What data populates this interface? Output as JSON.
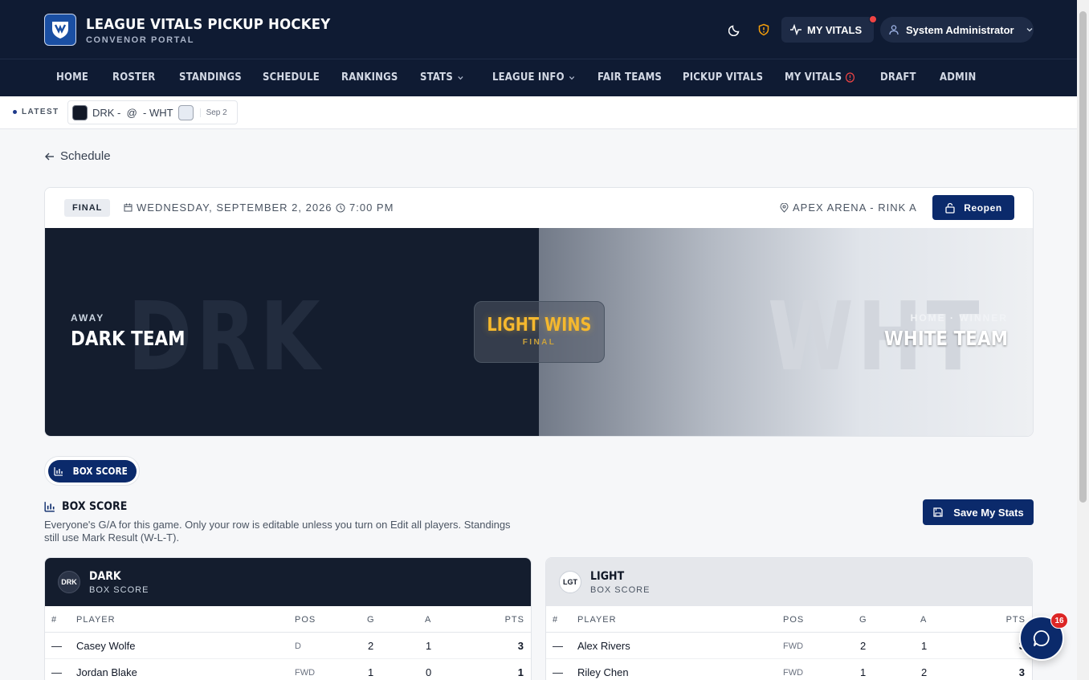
{
  "app": {
    "title": "LEAGUE VITALS PICKUP HOCKEY",
    "subtitle": "CONVENOR PORTAL"
  },
  "header": {
    "vitals_label": "MY VITALS",
    "user_name": "System Administrator"
  },
  "nav": {
    "items": [
      {
        "label": "HOME"
      },
      {
        "label": "ROSTER"
      },
      {
        "label": "STANDINGS"
      },
      {
        "label": "SCHEDULE"
      },
      {
        "label": "RANKINGS"
      },
      {
        "label": "STATS"
      },
      {
        "label": "LEAGUE INFO"
      },
      {
        "label": "FAIR TEAMS"
      },
      {
        "label": "PICKUP VITALS"
      },
      {
        "label": "MY VITALS"
      },
      {
        "label": "DRAFT"
      },
      {
        "label": "ADMIN"
      }
    ]
  },
  "ticker": {
    "latest_label": "LATEST",
    "game_text": "DRK -  @  - WHT",
    "date": "Sep 2"
  },
  "back_link": "Schedule",
  "game": {
    "status": "FINAL",
    "date": "WEDNESDAY, SEPTEMBER 2, 2026",
    "time": "7:00 PM",
    "location": "APEX ARENA - RINK A",
    "reopen_label": "Reopen",
    "away_label": "AWAY",
    "away_name": "DARK TEAM",
    "away_abbr": "DRK",
    "home_label": "HOME · WINNER",
    "home_name": "WHITE TEAM",
    "home_abbr": "WHT",
    "result": "LIGHT WINS",
    "result_sub": "FINAL"
  },
  "tabs": {
    "box_score": "BOX SCORE"
  },
  "box_score": {
    "title": "BOX SCORE",
    "description": "Everyone's G/A for this game. Only your row is editable unless you turn on Edit all players. Standings still use Mark Result (W-L-T).",
    "save_label": "Save My Stats",
    "columns": [
      "#",
      "PLAYER",
      "POS",
      "G",
      "A",
      "PTS"
    ],
    "teams": [
      {
        "abbr": "DRK",
        "name": "DARK",
        "sub": "BOX SCORE",
        "rows": [
          {
            "num": "—",
            "player": "Casey Wolfe",
            "pos": "D",
            "g": "2",
            "a": "1",
            "pts": "3"
          },
          {
            "num": "—",
            "player": "Jordan Blake",
            "pos": "FWD",
            "g": "1",
            "a": "0",
            "pts": "1"
          }
        ]
      },
      {
        "abbr": "LGT",
        "name": "LIGHT",
        "sub": "BOX SCORE",
        "rows": [
          {
            "num": "—",
            "player": "Alex Rivers",
            "pos": "FWD",
            "g": "2",
            "a": "1",
            "pts": "3"
          },
          {
            "num": "—",
            "player": "Riley Chen",
            "pos": "FWD",
            "g": "1",
            "a": "2",
            "pts": "3"
          }
        ]
      }
    ]
  },
  "chat": {
    "badge": "16"
  },
  "colors": {
    "navy": "#0f1b33",
    "primary": "#0b2a6b",
    "winner": "#f5b82e",
    "alert": "#ef4444"
  }
}
